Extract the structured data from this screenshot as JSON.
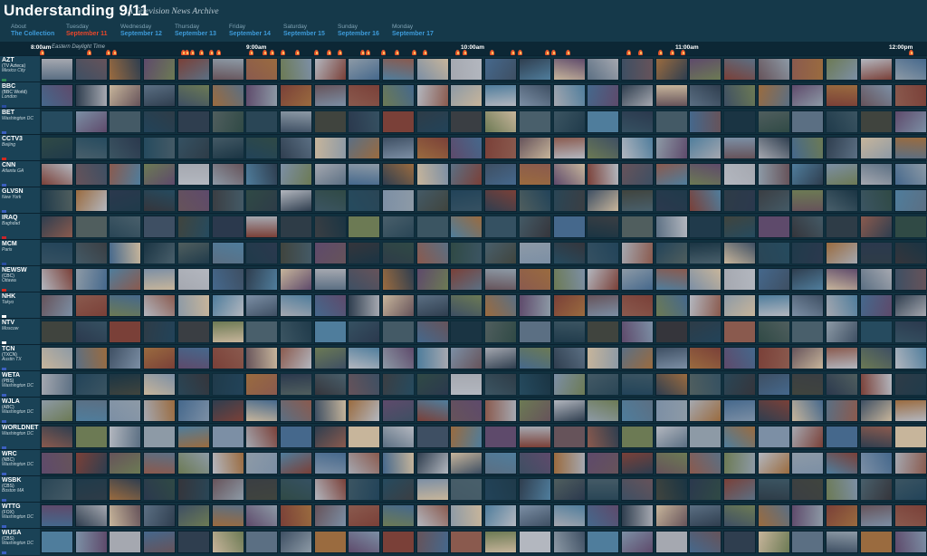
{
  "header": {
    "title": "Understanding 9/11",
    "subtitle": "A Television News Archive"
  },
  "days": [
    {
      "name": "About",
      "date": "The Collection",
      "active": false
    },
    {
      "name": "Tuesday",
      "date": "September 11",
      "active": true
    },
    {
      "name": "Wednesday",
      "date": "September 12",
      "active": false
    },
    {
      "name": "Thursday",
      "date": "September 13",
      "active": false
    },
    {
      "name": "Friday",
      "date": "September 14",
      "active": false
    },
    {
      "name": "Saturday",
      "date": "September 15",
      "active": false
    },
    {
      "name": "Sunday",
      "date": "September 16",
      "active": false
    },
    {
      "name": "Monday",
      "date": "September 17",
      "active": false
    }
  ],
  "timeline": {
    "times": [
      "8:00am",
      "9:00am",
      "10:00am",
      "11:00am",
      "12:00pm"
    ],
    "timezone": "Eastern Daylight Time",
    "marker_icon": "flame-icon"
  },
  "channels": [
    {
      "code": "AZT",
      "network": "(TV Azteca)",
      "city": "Mexico City",
      "flag_color": "#2e8b57",
      "dim_from": -1
    },
    {
      "code": "BBC",
      "network": "(BBC World)",
      "city": "London",
      "flag_color": "#2a4da0",
      "dim_from": -1
    },
    {
      "code": "BET",
      "network": "",
      "city": "Washington DC",
      "flag_color": "#3b5fbf",
      "dim_from": 0
    },
    {
      "code": "CCTV3",
      "network": "",
      "city": "Beijing",
      "flag_color": "#d42a1f",
      "dim_from": 7
    },
    {
      "code": "CNN",
      "network": "",
      "city": "Atlanta GA",
      "flag_color": "#3b5fbf",
      "dim_from": -1
    },
    {
      "code": "GLVSN",
      "network": "",
      "city": "New York",
      "flag_color": "#3b5fbf",
      "dim_from": 0
    },
    {
      "code": "IRAQ",
      "network": "",
      "city": "Baghdad",
      "flag_color": "#c9242a",
      "dim_from": 0
    },
    {
      "code": "MCM",
      "network": "",
      "city": "Paris",
      "flag_color": "#2a4da0",
      "dim_from": 0
    },
    {
      "code": "NEWSW",
      "network": "(CBC)",
      "city": "Ottawa",
      "flag_color": "#d42a1f",
      "dim_from": -1
    },
    {
      "code": "NHK",
      "network": "",
      "city": "Tokyo",
      "flag_color": "#ffffff",
      "dim_from": -1
    },
    {
      "code": "NTV",
      "network": "",
      "city": "Moscow",
      "flag_color": "#ffffff",
      "dim_from": 0
    },
    {
      "code": "TCN",
      "network": "(TXCN)",
      "city": "Austin TX",
      "flag_color": "#3b5fbf",
      "dim_from": -1
    },
    {
      "code": "WETA",
      "network": "(PBS)",
      "city": "Washington DC",
      "flag_color": "#3b5fbf",
      "dim_from": 0
    },
    {
      "code": "WJLA",
      "network": "(ABC)",
      "city": "Washington DC",
      "flag_color": "#3b5fbf",
      "dim_from": -1
    },
    {
      "code": "WORLDNET",
      "network": "",
      "city": "Washington DC",
      "flag_color": "#3b5fbf",
      "dim_from": -1
    },
    {
      "code": "WRC",
      "network": "(NBC)",
      "city": "Washington DC",
      "flag_color": "#3b5fbf",
      "dim_from": -1
    },
    {
      "code": "WSBK",
      "network": "(CBS)",
      "city": "Boston MA",
      "flag_color": "#3b5fbf",
      "dim_from": 0
    },
    {
      "code": "WTTG",
      "network": "(FOX)",
      "city": "Washington DC",
      "flag_color": "#3b5fbf",
      "dim_from": -1
    },
    {
      "code": "WUSA",
      "network": "(CBS)",
      "city": "Washington DC",
      "flag_color": "#3b5fbf",
      "dim_from": -1
    }
  ],
  "thumbnail_palette": [
    "#5b6f83",
    "#7c8fa5",
    "#8a5a4e",
    "#3e4f63",
    "#a5a8b0",
    "#6c7a54",
    "#9a6b3f",
    "#45688c",
    "#b3b7bf",
    "#5e4a6b",
    "#2f3e4f",
    "#8d9aa6",
    "#7a4038",
    "#c7b59b",
    "#4f7d9c",
    "#66535a"
  ]
}
